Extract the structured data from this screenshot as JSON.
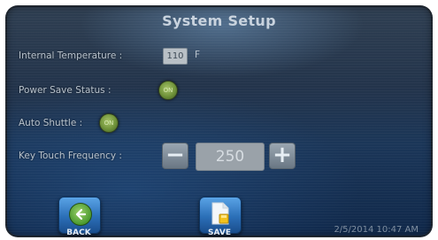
{
  "screen": {
    "title": "System Setup",
    "timestamp": "2/5/2014 10:47 AM"
  },
  "internal_temperature": {
    "label": "Internal Temperature :",
    "value": "110",
    "unit": "F"
  },
  "power_save": {
    "label": "Power Save Status :",
    "state_text": "ON",
    "icon": "toggle-on-icon"
  },
  "auto_shuttle": {
    "label": "Auto Shuttle :",
    "state_text": "ON",
    "icon": "toggle-on-icon"
  },
  "key_touch": {
    "label": "Key Touch Frequency :",
    "value": "250",
    "decrement_symbol": "−",
    "increment_symbol": "+"
  },
  "nav": {
    "back_label": "BACK",
    "save_label": "SAVE",
    "back_icon": "back-arrow-icon",
    "save_icon": "save-icon"
  },
  "colors": {
    "screen_bg": "#1b3658",
    "button_blue": "#2b6fb7",
    "toggle_green": "#6f9239",
    "stepper_gray": "#8d99a4"
  }
}
